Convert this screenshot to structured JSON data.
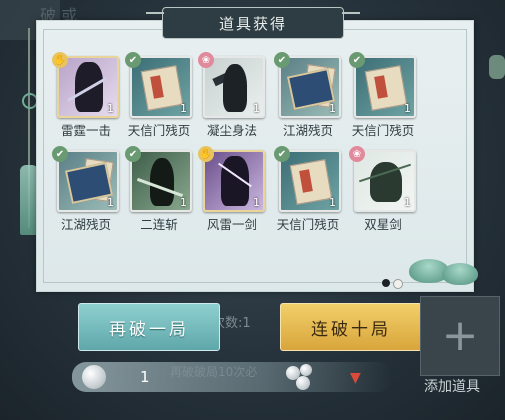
{
  "background": {
    "corner_text": "破 或",
    "hint_behind": "次数:1",
    "hint_behind_bottom": "再破破局10次必"
  },
  "panel": {
    "title": "道具获得"
  },
  "items": [
    {
      "label": "雷霆一击",
      "count": "1",
      "badge": "gold",
      "frame": "gold",
      "art": "purple"
    },
    {
      "label": "天信门残页",
      "count": "1",
      "badge": "green",
      "frame": "plain",
      "art": "scroll"
    },
    {
      "label": "凝尘身法",
      "count": "1",
      "badge": "pink",
      "frame": "plain",
      "art": "dark"
    },
    {
      "label": "江湖残页",
      "count": "1",
      "badge": "green",
      "frame": "plain",
      "art": "book"
    },
    {
      "label": "天信门残页",
      "count": "1",
      "badge": "green",
      "frame": "plain",
      "art": "scroll"
    },
    {
      "label": "江湖残页",
      "count": "1",
      "badge": "green",
      "frame": "plain",
      "art": "book"
    },
    {
      "label": "二连斩",
      "count": "1",
      "badge": "green",
      "frame": "plain",
      "art": "green"
    },
    {
      "label": "风雷一剑",
      "count": "1",
      "badge": "gold",
      "frame": "gold",
      "art": "violet"
    },
    {
      "label": "天信门残页",
      "count": "1",
      "badge": "green",
      "frame": "plain",
      "art": "scroll"
    },
    {
      "label": "双星剑",
      "count": "1",
      "badge": "pink",
      "frame": "plain",
      "art": "duo"
    }
  ],
  "buttons": {
    "retry_once": "再破一局",
    "retry_ten": "连破十局"
  },
  "add_item": {
    "symbol": "+",
    "label": "添加道具"
  },
  "resource": {
    "count": "1",
    "pin_icon": "location-pin-icon"
  },
  "colors": {
    "teal_button": "#6fb8ba",
    "gold_button": "#e4b650",
    "panel_bg": "#e3ecee",
    "title_bg": "#2e3c44"
  }
}
